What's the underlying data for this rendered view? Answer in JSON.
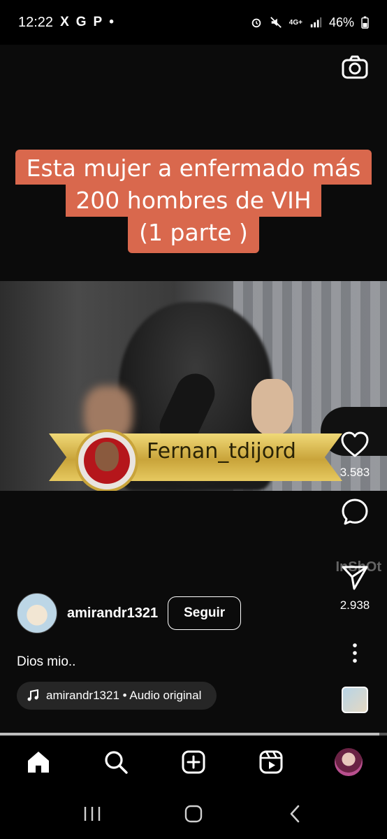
{
  "status_bar": {
    "time": "12:22",
    "notif_icons": [
      "X",
      "G",
      "P",
      "•"
    ],
    "signal": "4G+",
    "battery": "46%"
  },
  "reel": {
    "caption_lines": [
      "Esta mujer a enfermado más",
      "200 hombres de VIH",
      "(1 parte )"
    ],
    "banner_text": "Fernan_tdijord",
    "watermark": "InShOt",
    "likes": "3.583",
    "shares": "2.938",
    "author": "amirandr1321",
    "follow_label": "Seguir",
    "post_caption": "Dios mio..",
    "audio_label": "amirandr1321 • Audio original",
    "progress_fraction": 0.98
  },
  "colors": {
    "caption_bg": "#d9684d",
    "banner_gold": "#d8b84f",
    "pill_bg": "#262626"
  }
}
